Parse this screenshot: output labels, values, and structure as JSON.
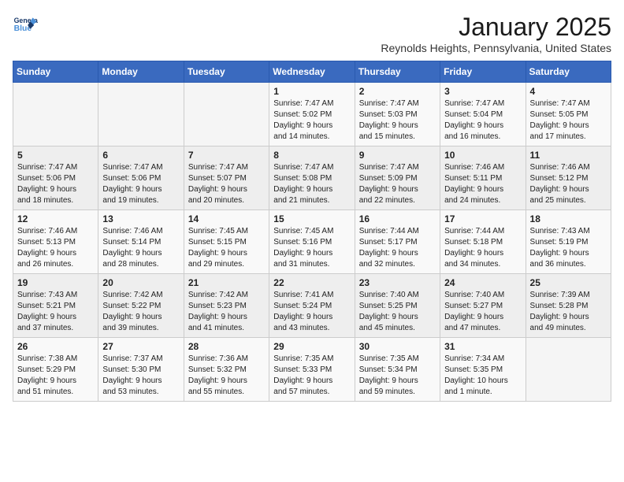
{
  "header": {
    "logo_line1": "General",
    "logo_line2": "Blue",
    "month": "January 2025",
    "location": "Reynolds Heights, Pennsylvania, United States"
  },
  "weekdays": [
    "Sunday",
    "Monday",
    "Tuesday",
    "Wednesday",
    "Thursday",
    "Friday",
    "Saturday"
  ],
  "weeks": [
    [
      {
        "day": "",
        "info": ""
      },
      {
        "day": "",
        "info": ""
      },
      {
        "day": "",
        "info": ""
      },
      {
        "day": "1",
        "info": "Sunrise: 7:47 AM\nSunset: 5:02 PM\nDaylight: 9 hours\nand 14 minutes."
      },
      {
        "day": "2",
        "info": "Sunrise: 7:47 AM\nSunset: 5:03 PM\nDaylight: 9 hours\nand 15 minutes."
      },
      {
        "day": "3",
        "info": "Sunrise: 7:47 AM\nSunset: 5:04 PM\nDaylight: 9 hours\nand 16 minutes."
      },
      {
        "day": "4",
        "info": "Sunrise: 7:47 AM\nSunset: 5:05 PM\nDaylight: 9 hours\nand 17 minutes."
      }
    ],
    [
      {
        "day": "5",
        "info": "Sunrise: 7:47 AM\nSunset: 5:06 PM\nDaylight: 9 hours\nand 18 minutes."
      },
      {
        "day": "6",
        "info": "Sunrise: 7:47 AM\nSunset: 5:06 PM\nDaylight: 9 hours\nand 19 minutes."
      },
      {
        "day": "7",
        "info": "Sunrise: 7:47 AM\nSunset: 5:07 PM\nDaylight: 9 hours\nand 20 minutes."
      },
      {
        "day": "8",
        "info": "Sunrise: 7:47 AM\nSunset: 5:08 PM\nDaylight: 9 hours\nand 21 minutes."
      },
      {
        "day": "9",
        "info": "Sunrise: 7:47 AM\nSunset: 5:09 PM\nDaylight: 9 hours\nand 22 minutes."
      },
      {
        "day": "10",
        "info": "Sunrise: 7:46 AM\nSunset: 5:11 PM\nDaylight: 9 hours\nand 24 minutes."
      },
      {
        "day": "11",
        "info": "Sunrise: 7:46 AM\nSunset: 5:12 PM\nDaylight: 9 hours\nand 25 minutes."
      }
    ],
    [
      {
        "day": "12",
        "info": "Sunrise: 7:46 AM\nSunset: 5:13 PM\nDaylight: 9 hours\nand 26 minutes."
      },
      {
        "day": "13",
        "info": "Sunrise: 7:46 AM\nSunset: 5:14 PM\nDaylight: 9 hours\nand 28 minutes."
      },
      {
        "day": "14",
        "info": "Sunrise: 7:45 AM\nSunset: 5:15 PM\nDaylight: 9 hours\nand 29 minutes."
      },
      {
        "day": "15",
        "info": "Sunrise: 7:45 AM\nSunset: 5:16 PM\nDaylight: 9 hours\nand 31 minutes."
      },
      {
        "day": "16",
        "info": "Sunrise: 7:44 AM\nSunset: 5:17 PM\nDaylight: 9 hours\nand 32 minutes."
      },
      {
        "day": "17",
        "info": "Sunrise: 7:44 AM\nSunset: 5:18 PM\nDaylight: 9 hours\nand 34 minutes."
      },
      {
        "day": "18",
        "info": "Sunrise: 7:43 AM\nSunset: 5:19 PM\nDaylight: 9 hours\nand 36 minutes."
      }
    ],
    [
      {
        "day": "19",
        "info": "Sunrise: 7:43 AM\nSunset: 5:21 PM\nDaylight: 9 hours\nand 37 minutes."
      },
      {
        "day": "20",
        "info": "Sunrise: 7:42 AM\nSunset: 5:22 PM\nDaylight: 9 hours\nand 39 minutes."
      },
      {
        "day": "21",
        "info": "Sunrise: 7:42 AM\nSunset: 5:23 PM\nDaylight: 9 hours\nand 41 minutes."
      },
      {
        "day": "22",
        "info": "Sunrise: 7:41 AM\nSunset: 5:24 PM\nDaylight: 9 hours\nand 43 minutes."
      },
      {
        "day": "23",
        "info": "Sunrise: 7:40 AM\nSunset: 5:25 PM\nDaylight: 9 hours\nand 45 minutes."
      },
      {
        "day": "24",
        "info": "Sunrise: 7:40 AM\nSunset: 5:27 PM\nDaylight: 9 hours\nand 47 minutes."
      },
      {
        "day": "25",
        "info": "Sunrise: 7:39 AM\nSunset: 5:28 PM\nDaylight: 9 hours\nand 49 minutes."
      }
    ],
    [
      {
        "day": "26",
        "info": "Sunrise: 7:38 AM\nSunset: 5:29 PM\nDaylight: 9 hours\nand 51 minutes."
      },
      {
        "day": "27",
        "info": "Sunrise: 7:37 AM\nSunset: 5:30 PM\nDaylight: 9 hours\nand 53 minutes."
      },
      {
        "day": "28",
        "info": "Sunrise: 7:36 AM\nSunset: 5:32 PM\nDaylight: 9 hours\nand 55 minutes."
      },
      {
        "day": "29",
        "info": "Sunrise: 7:35 AM\nSunset: 5:33 PM\nDaylight: 9 hours\nand 57 minutes."
      },
      {
        "day": "30",
        "info": "Sunrise: 7:35 AM\nSunset: 5:34 PM\nDaylight: 9 hours\nand 59 minutes."
      },
      {
        "day": "31",
        "info": "Sunrise: 7:34 AM\nSunset: 5:35 PM\nDaylight: 10 hours\nand 1 minute."
      },
      {
        "day": "",
        "info": ""
      }
    ]
  ]
}
